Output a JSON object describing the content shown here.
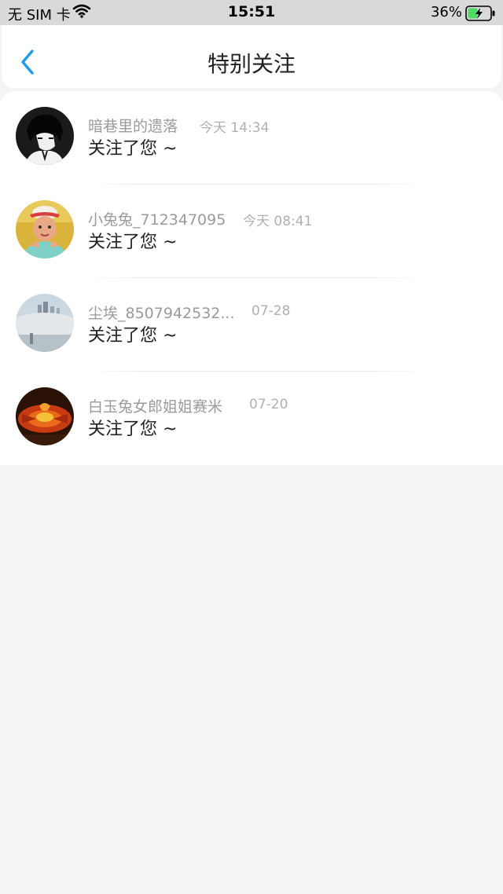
{
  "status_bar": {
    "carrier": "无 SIM 卡",
    "time": "15:51",
    "battery_pct": "36%"
  },
  "nav": {
    "back_icon": "chevron-left-icon",
    "title": "特别关注",
    "accent": "#1e9bea"
  },
  "items": [
    {
      "name": "暗巷里的遗落",
      "time": "今天 14:34",
      "message": "关注了您 ~"
    },
    {
      "name": "小兔兔_712347095",
      "time": "今天 08:41",
      "message": "关注了您 ~"
    },
    {
      "name": "尘埃_8507942532...",
      "time": "07-28",
      "message": "关注了您 ~"
    },
    {
      "name": "白玉兔女郎姐姐赛米",
      "time": "07-20",
      "message": "关注了您 ~"
    }
  ]
}
